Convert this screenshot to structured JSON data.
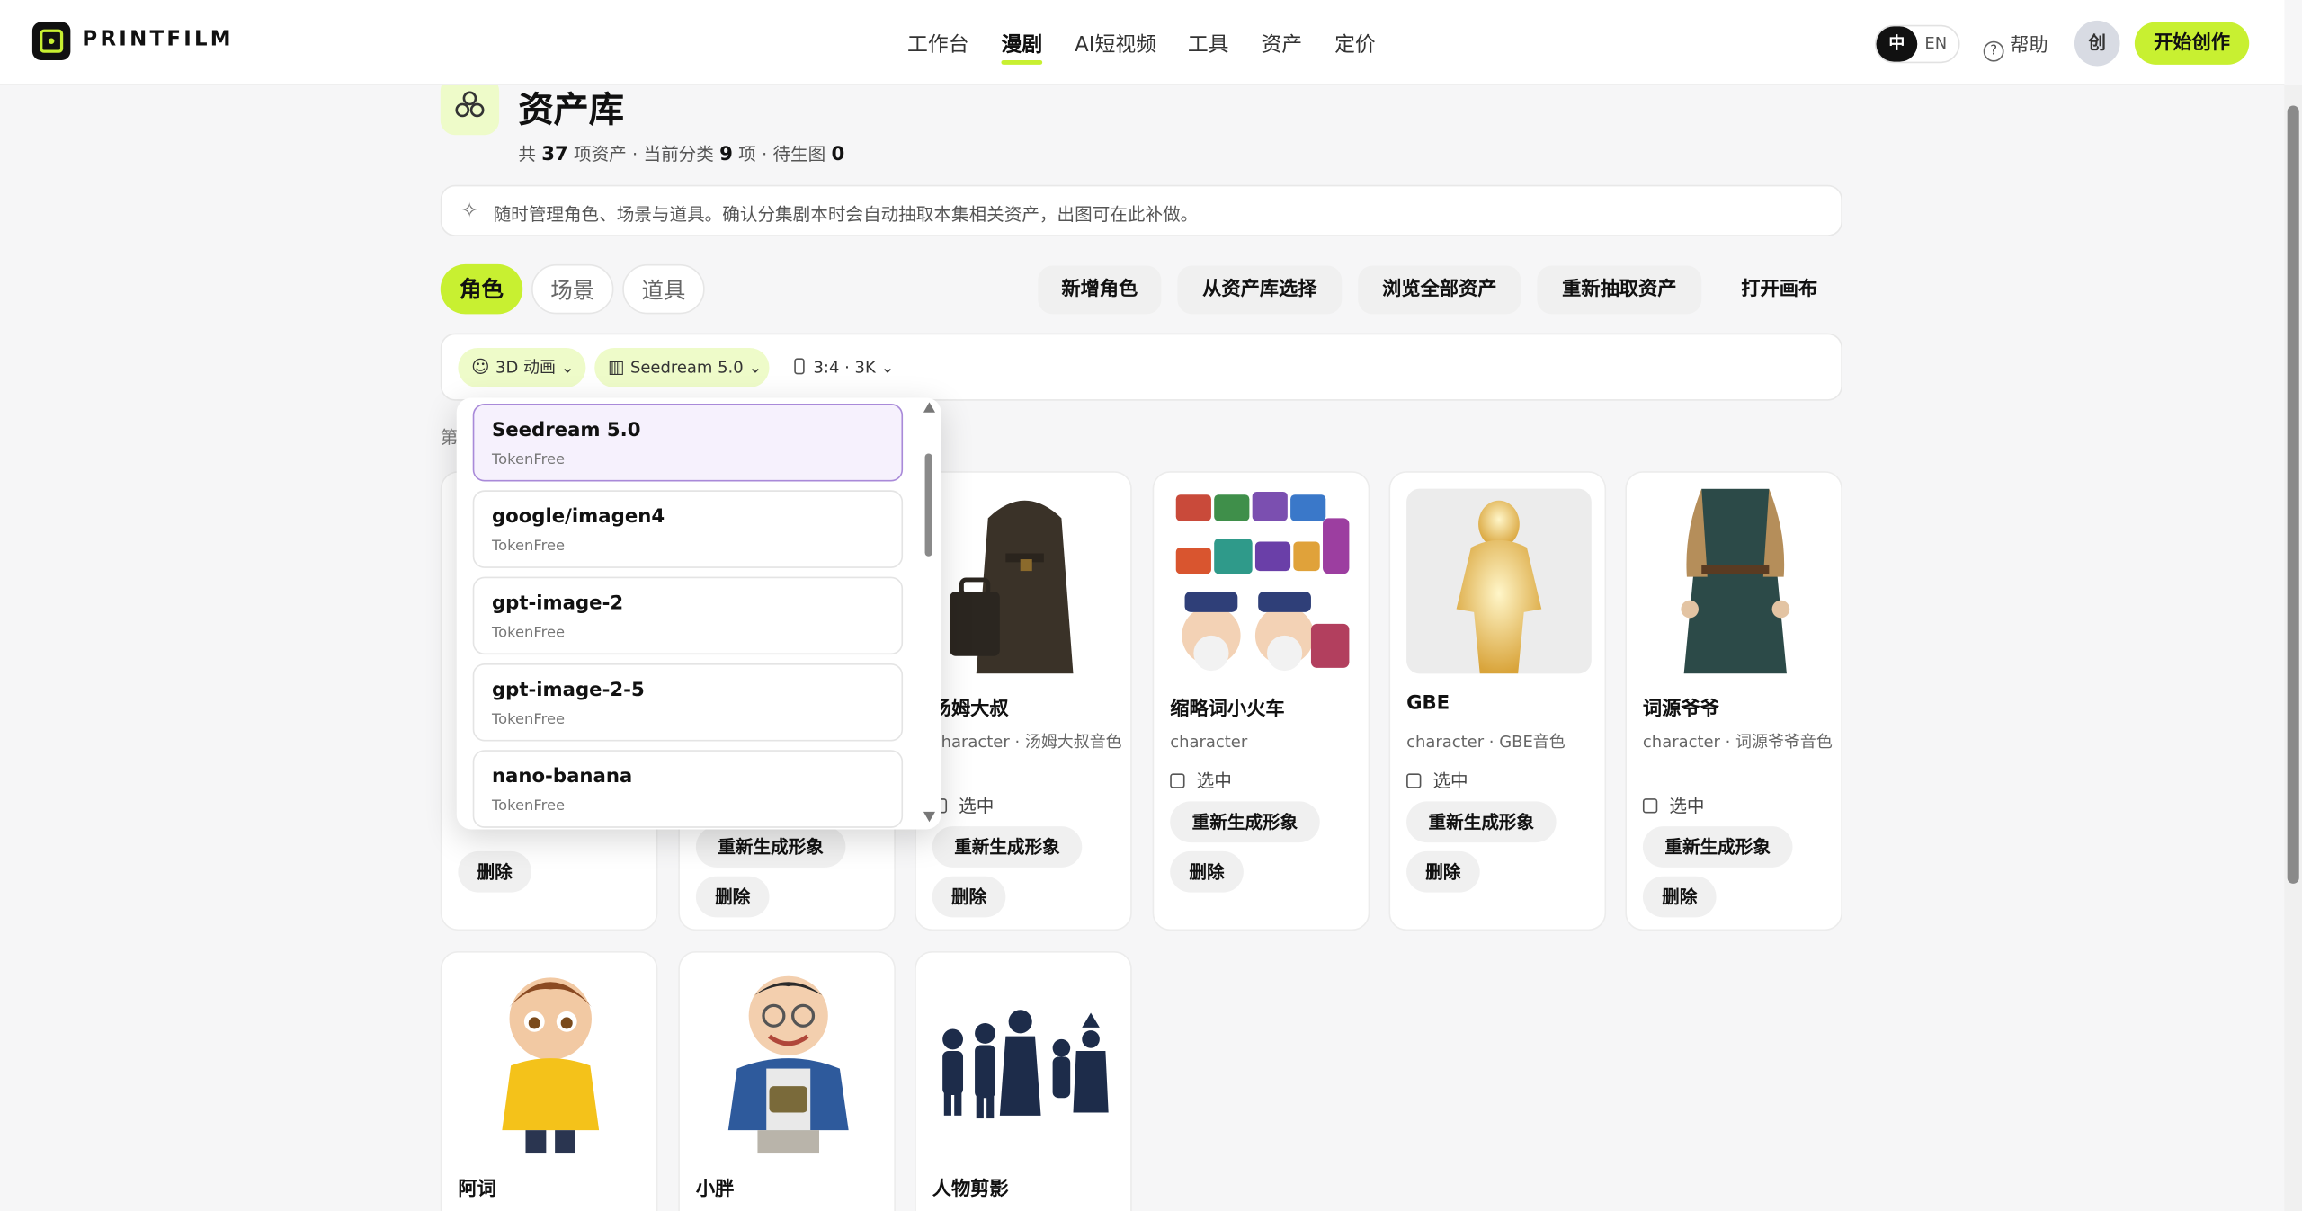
{
  "header": {
    "brand": "PRINTFILM",
    "nav": [
      "工作台",
      "漫剧",
      "AI短视频",
      "工具",
      "资产",
      "定价"
    ],
    "active_nav": "漫剧",
    "lang_zh": "中",
    "lang_en": "EN",
    "help": "帮助",
    "avatar": "创",
    "cta": "开始创作",
    "accent_color": "#c8f031"
  },
  "page": {
    "title": "资产库",
    "stats": {
      "p1": "共",
      "total": "37",
      "p2": "项资产",
      "p3": "当前分类",
      "cat": "9",
      "p4": "项",
      "p5": "待生图",
      "pending": "0"
    },
    "notice": "随时管理角色、场景与道具。确认分集剧本时会自动抽取本集相关资产，出图可在此补做。"
  },
  "tabs": [
    "角色",
    "场景",
    "道具"
  ],
  "actions": [
    "新增角色",
    "从资产库选择",
    "浏览全部资产",
    "重新抽取资产",
    "打开画布"
  ],
  "filters": {
    "style": "3D 动画",
    "model": "Seedream 5.0",
    "ratio": "3:4",
    "res": "3K"
  },
  "section_prefix": "第",
  "dropdown": {
    "options": [
      {
        "name": "Seedream 5.0",
        "provider": "TokenFree",
        "selected": true
      },
      {
        "name": "google/imagen4",
        "provider": "TokenFree"
      },
      {
        "name": "gpt-image-2",
        "provider": "TokenFree"
      },
      {
        "name": "gpt-image-2-5",
        "provider": "TokenFree"
      },
      {
        "name": "nano-banana",
        "provider": "TokenFree"
      }
    ]
  },
  "cards": [
    {
      "name": "汤姆大叔",
      "meta": "character · 汤姆大叔音色",
      "meta_visible": "haracter · 汤姆大叔音色"
    },
    {
      "name": "缩略词小火车",
      "meta": "character"
    },
    {
      "name": "GBE",
      "meta": "character · GBE音色"
    },
    {
      "name": "词源爷爷",
      "meta": "character · 词源爷爷音色"
    },
    {
      "name": "阿词"
    },
    {
      "name": "小胖"
    },
    {
      "name": "人物剪影"
    }
  ],
  "labels": {
    "select": "选中",
    "regen": "重新生成形象",
    "delete": "删除"
  }
}
